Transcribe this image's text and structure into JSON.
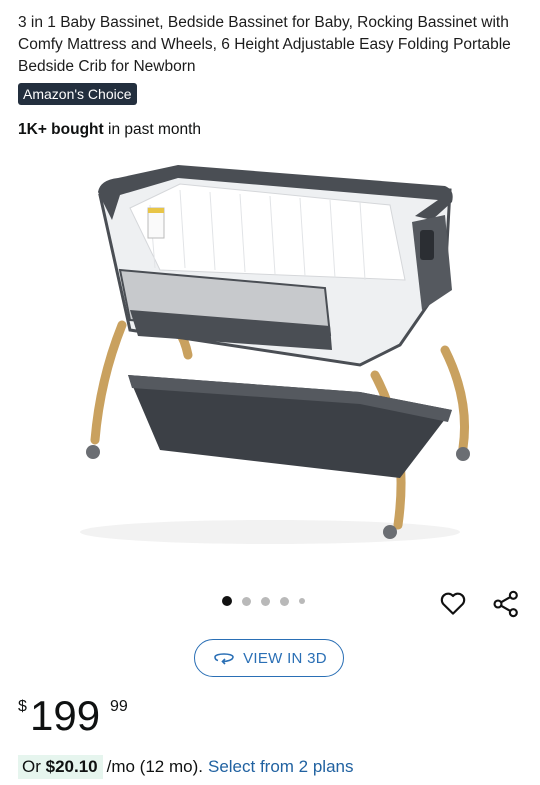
{
  "product": {
    "title": "3 in 1 Baby Bassinet, Bedside Bassinet for Baby, Rocking Bassinet with Comfy Mattress and Wheels, 6 Height Adjustable Easy Folding Portable Bedside Crib for Newborn",
    "badge": "Amazon's Choice",
    "bought_count": "1K+ bought",
    "bought_suffix": " in past month"
  },
  "gallery": {
    "dot_count": 5,
    "active_index": 0,
    "view_3d_label": "VIEW IN 3D"
  },
  "icons": {
    "wishlist": "heart-icon",
    "share": "share-icon",
    "rotate": "rotate-3d-icon"
  },
  "pricing": {
    "currency": "$",
    "whole": "199",
    "fraction": "99",
    "monthly_prefix": "Or",
    "monthly_amount": "$20.10",
    "monthly_terms": "/mo (12 mo).",
    "plans_link": "Select from 2 plans"
  },
  "colors": {
    "link": "#2162a1",
    "badge_bg": "#232f3e",
    "view3d": "#2a6fb5",
    "monthly_highlight": "#e6f5ee"
  }
}
